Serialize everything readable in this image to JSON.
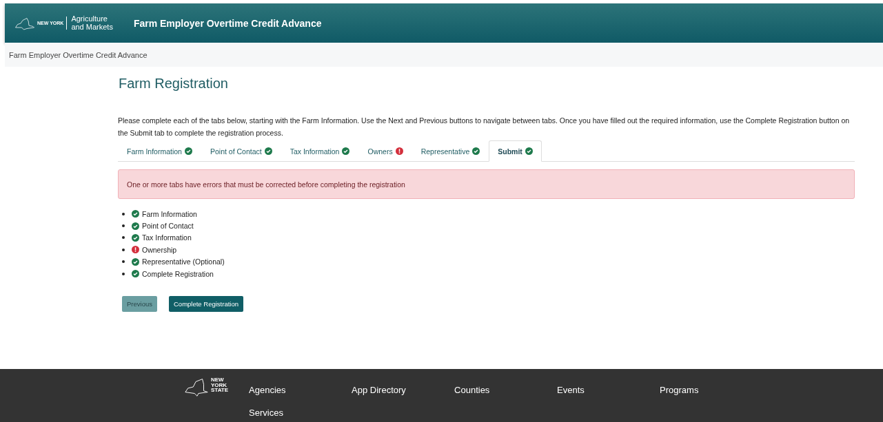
{
  "header": {
    "logo": {
      "state_lines": [
        "NEW YORK"
      ],
      "agency_lines": [
        "Agriculture",
        "and Markets"
      ]
    },
    "title": "Farm Employer Overtime Credit Advance"
  },
  "breadcrumb": "Farm Employer Overtime Credit Advance",
  "page_title": "Farm Registration",
  "intro": "Please complete each of the tabs below, starting with the Farm Information. Use the Next and Previous buttons to navigate between tabs. Once you have filled out the required information, use the Complete Registration button on the Submit tab to complete the registration process.",
  "tabs": [
    {
      "label": "Farm Information",
      "has_error": false,
      "selected": false
    },
    {
      "label": "Point of Contact",
      "has_error": false,
      "selected": false
    },
    {
      "label": "Tax Information",
      "has_error": false,
      "selected": false
    },
    {
      "label": "Owners",
      "has_error": true,
      "selected": false
    },
    {
      "label": "Representative",
      "has_error": false,
      "selected": false
    },
    {
      "label": "Submit",
      "has_error": false,
      "selected": true
    }
  ],
  "alert": "One or more tabs have errors that must be corrected before completing the registration",
  "checklist": [
    {
      "label": "Farm Information",
      "has_error": false
    },
    {
      "label": "Point of Contact",
      "has_error": false
    },
    {
      "label": "Tax Information",
      "has_error": false
    },
    {
      "label": "Ownership",
      "has_error": true
    },
    {
      "label": "Representative (Optional)",
      "has_error": false
    },
    {
      "label": "Complete Registration",
      "has_error": false
    }
  ],
  "buttons": [
    {
      "label": "Previous",
      "kind": "secondary"
    },
    {
      "label": "Complete Registration",
      "kind": "primary"
    }
  ],
  "footer": {
    "logo_lines": [
      "NEW",
      "YORK",
      "STATE"
    ],
    "links": [
      "Agencies",
      "App Directory",
      "Counties",
      "Events",
      "Programs",
      "Services"
    ]
  }
}
